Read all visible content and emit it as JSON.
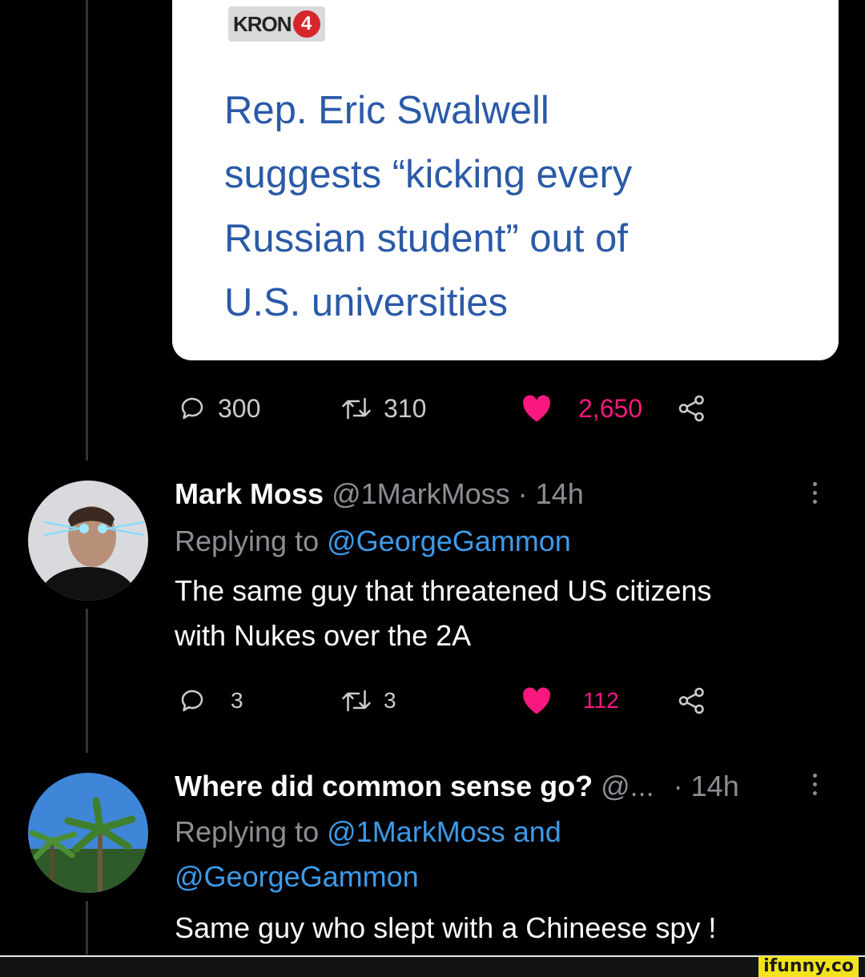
{
  "news_card": {
    "source_logo": "KRON",
    "source_logo_number": "4",
    "headline_lines": [
      "Rep. Eric Swalwell",
      "suggests “kicking every",
      "Russian student” out of",
      "U.S. universities"
    ]
  },
  "main_actions": {
    "replies": "300",
    "retweets": "310",
    "likes": "2,650"
  },
  "reply1": {
    "name": "Mark Moss",
    "handle_time": "@1MarkMoss · 14h",
    "replying_prefix": "Replying to",
    "replying_to": "@GeorgeGammon",
    "text_lines": [
      "The same guy that threatened US citizens",
      "with Nukes over the 2A"
    ],
    "actions": {
      "replies": "3",
      "retweets": "3",
      "likes": "112"
    }
  },
  "reply2": {
    "name": "Where did common sense go?",
    "handle": "@...",
    "time": "· 14h",
    "replying_prefix": "Replying to",
    "replying_to_line1": "@1MarkMoss and",
    "replying_to_line2": "@GeorgeGammon",
    "text": "Same guy who slept with a Chineese spy !"
  },
  "watermark": "ifunny.co",
  "colors": {
    "like": "#f91880",
    "link": "#3d9be9",
    "headline": "#2a5aa8",
    "kron_red": "#d6262c"
  },
  "icons": [
    "reply-icon",
    "retweet-icon",
    "heart-icon",
    "share-icon",
    "more-icon"
  ]
}
